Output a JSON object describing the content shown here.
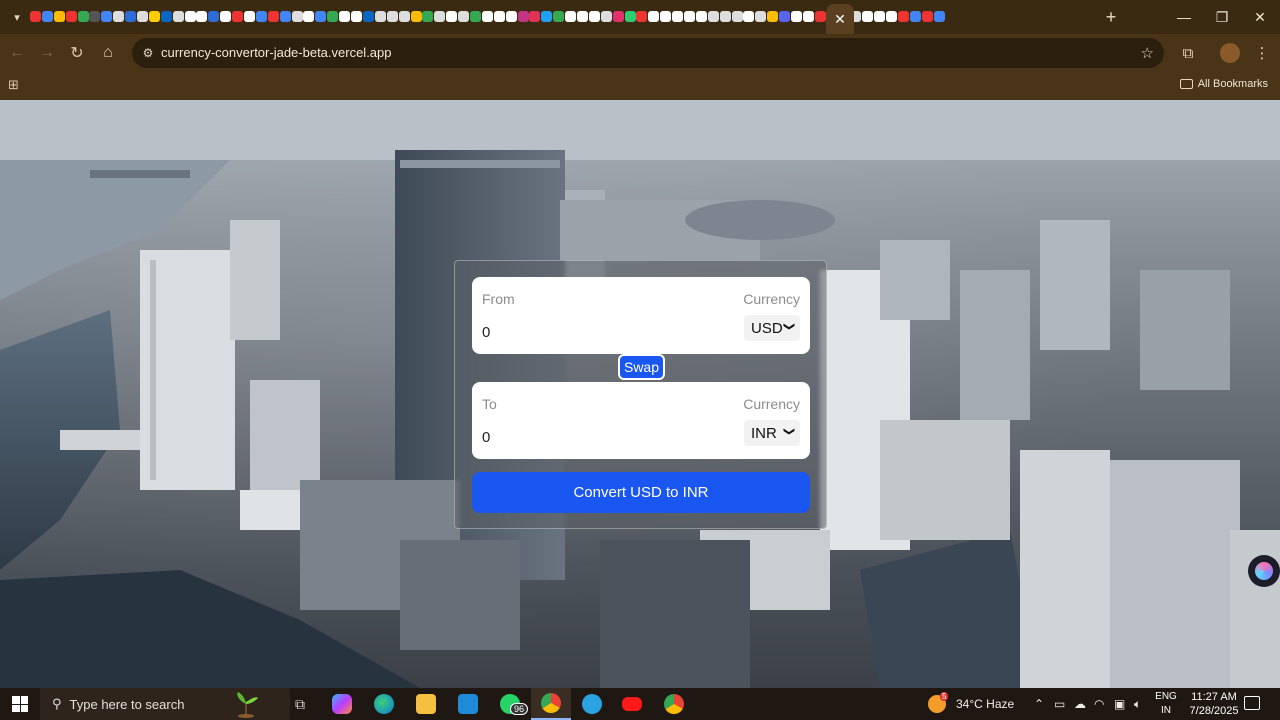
{
  "browser": {
    "url": "currency-convertor-jade-beta.vercel.app",
    "bookmarks_label": "All Bookmarks",
    "active_tab_close": "✕",
    "new_tab": "+",
    "pinned_tab_colors": [
      "#e33",
      "#4285f4",
      "#fbbc05",
      "#e33",
      "#34a853",
      "#555",
      "#4285f4",
      "#ddd",
      "#2d6bd6",
      "#ddd",
      "#ffcc00",
      "#0a66c2",
      "#ddd",
      "#fff",
      "#fff",
      "#2d6bd6",
      "#fff",
      "#e33",
      "#fff",
      "#4285f4",
      "#e33",
      "#4285f4",
      "#ddd",
      "#fff",
      "#4285f4",
      "#34a853",
      "#fff",
      "#fff",
      "#0a66c2",
      "#ddd",
      "#ddd",
      "#ddd",
      "#fbbc05",
      "#34a853",
      "#ddd",
      "#fff",
      "#ddd",
      "#34a853",
      "#fff",
      "#fff",
      "#fff",
      "#c13584",
      "#d35",
      "#1da1f2",
      "#34a853",
      "#fff",
      "#fff",
      "#fff",
      "#ddd",
      "#e1306c",
      "#2ecc71",
      "#e33",
      "#fff",
      "#fff",
      "#fff",
      "#fff",
      "#fff",
      "#ddd",
      "#ddd",
      "#ddd",
      "#fff",
      "#ddd",
      "#fbbc05",
      "#5865f2",
      "#fff",
      "#fff",
      "#e33",
      "#fff",
      "#fff",
      "#ddd",
      "#fff",
      "#fff",
      "#fff",
      "#e33",
      "#4285f4",
      "#e33",
      "#4285f4"
    ]
  },
  "converter": {
    "from": {
      "label": "From",
      "currency_label": "Currency",
      "amount": "0",
      "currency": "USD"
    },
    "to": {
      "label": "To",
      "currency_label": "Currency",
      "amount": "0",
      "currency": "INR"
    },
    "swap_label": "Swap",
    "convert_label": "Convert USD to INR"
  },
  "taskbar": {
    "search_placeholder": "Type here to search",
    "whatsapp_badge": "96",
    "weather": "34°C  Haze",
    "weather_badge": "5",
    "lang_line1": "ENG",
    "lang_line2": "IN",
    "time": "11:27 AM",
    "date": "7/28/2025"
  }
}
